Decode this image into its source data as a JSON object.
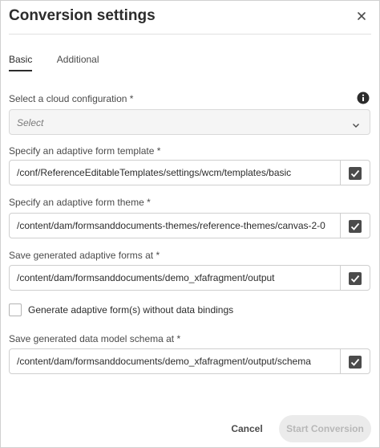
{
  "dialog": {
    "title": "Conversion settings",
    "close_icon": "close-icon"
  },
  "tabs": [
    {
      "label": "Basic",
      "active": true
    },
    {
      "label": "Additional",
      "active": false
    }
  ],
  "cloud_config": {
    "label": "Select a cloud configuration *",
    "placeholder": "Select",
    "info_icon": "info-icon"
  },
  "template": {
    "label": "Specify an adaptive form template *",
    "value": "/conf/ReferenceEditableTemplates/settings/wcm/templates/basic",
    "checked": true
  },
  "theme": {
    "label": "Specify an adaptive form theme *",
    "value": "/content/dam/formsanddocuments-themes/reference-themes/canvas-2-0",
    "checked": true
  },
  "forms_output": {
    "label": "Save generated adaptive forms at *",
    "value": "/content/dam/formsanddocuments/demo_xfafragment/output",
    "checked": true
  },
  "no_bindings": {
    "label": "Generate adaptive form(s) without data bindings",
    "checked": false
  },
  "schema_output": {
    "label": "Save generated data model schema at *",
    "value": "/content/dam/formsanddocuments/demo_xfafragment/output/schema",
    "checked": true
  },
  "footer": {
    "cancel_label": "Cancel",
    "start_label": "Start Conversion",
    "start_enabled": false
  },
  "colors": {
    "accent": "#2c2c2c",
    "checkbox_fill": "#4b4b4b",
    "disabled_bg": "#ebebeb",
    "disabled_text": "#b8b8b8"
  }
}
